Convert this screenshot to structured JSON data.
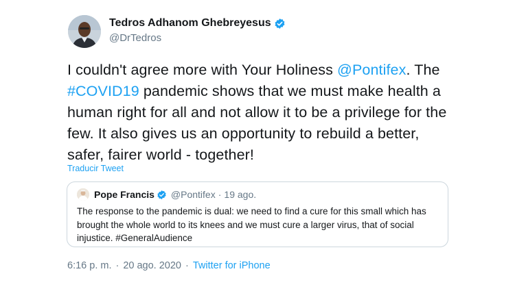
{
  "author": {
    "name": "Tedros Adhanom Ghebreyesus",
    "handle": "@DrTedros",
    "verified": true
  },
  "tweet": {
    "text_1": "I couldn't agree more with Your Holiness ",
    "mention": "@Pontifex",
    "text_2": ". The ",
    "hashtag": "#COVID19",
    "text_3": " pandemic shows that we must make health a human right for all and not allow it to be a privilege for the few. It also gives us an opportunity to rebuild a better, safer, fairer world - together!",
    "translate_label": "Traducir Tweet"
  },
  "quoted_tweet": {
    "name": "Pope Francis",
    "handle": "@Pontifex",
    "separator": "·",
    "time": "19 ago.",
    "text_1": "The response to the pandemic is dual: we need to find a cure for this small which has brought the whole world to its knees and we must cure a larger virus, that of social injustice. ",
    "hashtag": "#GeneralAudience"
  },
  "meta": {
    "time": "6:16 p. m.",
    "separator": "·",
    "date": "20 ago. 2020",
    "source": "Twitter for iPhone"
  },
  "colors": {
    "accent": "#1da1f2",
    "text": "#14171a",
    "secondary": "#657786",
    "border": "#ccd6dd"
  },
  "icons": {
    "verified": "verified-badge-icon"
  }
}
